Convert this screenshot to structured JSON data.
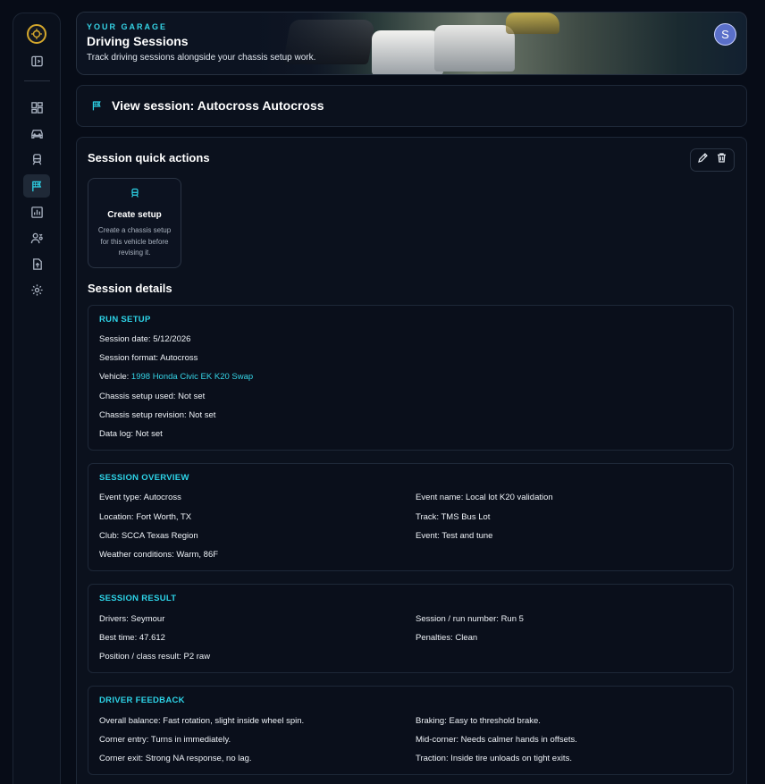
{
  "colors": {
    "accent": "#2dd4e8",
    "bg": "#070c17",
    "card": "#0b111d",
    "gold": "#d4a72c"
  },
  "sidebar": {
    "items": [
      {
        "icon": "collapse-sidebar-icon"
      },
      {
        "icon": "dashboard-icon"
      },
      {
        "icon": "car-icon"
      },
      {
        "icon": "chassis-icon"
      },
      {
        "icon": "flag-icon",
        "active": true
      },
      {
        "icon": "analytics-icon"
      },
      {
        "icon": "drivers-icon"
      },
      {
        "icon": "upload-icon"
      },
      {
        "icon": "gear-icon"
      }
    ]
  },
  "hero": {
    "eyebrow": "YOUR GARAGE",
    "title": "Driving Sessions",
    "subtitle": "Track driving sessions alongside your chassis setup work.",
    "avatar_initial": "S"
  },
  "view": {
    "title": "View session: Autocross Autocross"
  },
  "quick_actions": {
    "title": "Session quick actions",
    "card_title": "Create setup",
    "card_desc": "Create a chassis setup for this vehicle before revising it."
  },
  "details": {
    "title": "Session details",
    "run_setup": {
      "heading": "RUN SETUP",
      "session_date": "Session date: 5/12/2026",
      "session_format": "Session format: Autocross",
      "vehicle_label": "Vehicle: ",
      "vehicle_link": "1998 Honda Civic EK K20 Swap",
      "chassis_setup": "Chassis setup used: Not set",
      "chassis_revision": "Chassis setup revision: Not set",
      "data_log": "Data log: Not set"
    },
    "overview": {
      "heading": "SESSION OVERVIEW",
      "event_type": "Event type: Autocross",
      "event_name": "Event name: Local lot K20 validation",
      "location": "Location: Fort Worth, TX",
      "track": "Track: TMS Bus Lot",
      "club": "Club: SCCA Texas Region",
      "event": "Event: Test and tune",
      "weather": "Weather conditions: Warm, 86F"
    },
    "result": {
      "heading": "SESSION RESULT",
      "drivers": "Drivers: Seymour",
      "run_number": "Session / run number: Run 5",
      "best_time": "Best time: 47.612",
      "penalties": "Penalties: Clean",
      "position": "Position / class result: P2 raw"
    },
    "feedback": {
      "heading": "DRIVER FEEDBACK",
      "balance": "Overall balance: Fast rotation, slight inside wheel spin.",
      "braking": "Braking: Easy to threshold brake.",
      "entry": "Corner entry: Turns in immediately.",
      "mid": "Mid-corner: Needs calmer hands in offsets.",
      "exit": "Corner exit: Strong NA response, no lag.",
      "traction": "Traction: Inside tire unloads on tight exits."
    }
  }
}
